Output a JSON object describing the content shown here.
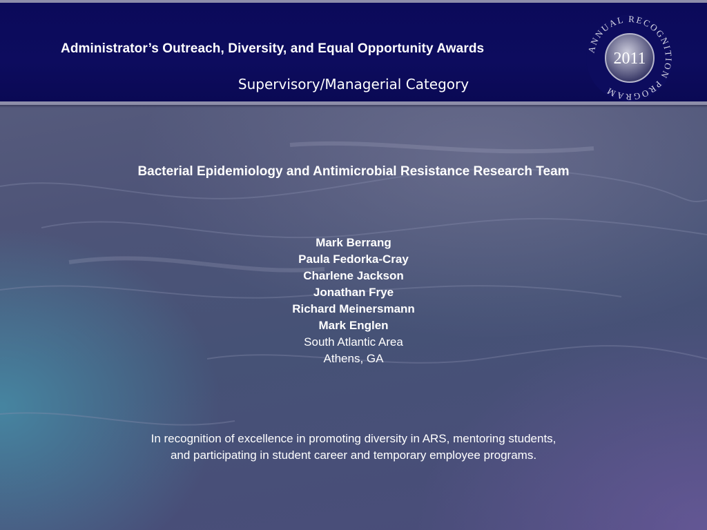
{
  "header": {
    "award_title": "Administrator’s Outreach, Diversity, and Equal Opportunity Awards",
    "category": "Supervisory/Managerial Category",
    "seal": {
      "ring_text": "ANNUAL RECOGNITION PROGRAM",
      "year": "2011"
    }
  },
  "team": {
    "title": "Bacterial Epidemiology and Antimicrobial Resistance Research Team",
    "members": [
      "Mark Berrang",
      "Paula Fedorka-Cray",
      "Charlene Jackson",
      "Jonathan Frye",
      "Richard Meinersmann",
      "Mark Englen"
    ],
    "area": "South Atlantic Area",
    "city": "Athens, GA"
  },
  "recognition": "In recognition of excellence in promoting diversity in ARS, mentoring students, and participating in student career and temporary employee programs.",
  "colors": {
    "header_bg": "#0d0c5e",
    "header_border": "#8e8eaa",
    "text": "#ffffff"
  }
}
